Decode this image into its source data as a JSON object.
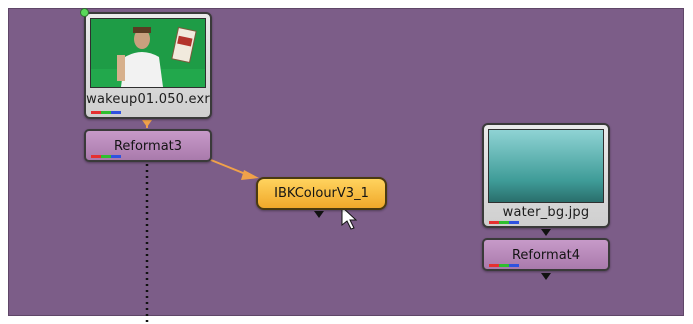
{
  "graph": {
    "background": "#7c5d88",
    "nodes": {
      "read_wakeup": {
        "label": "wakeup01.050.exr",
        "channel_colors": [
          "#e53030",
          "#2fbf2f",
          "#2f52e0"
        ]
      },
      "reformat3": {
        "label": "Reformat3",
        "channel_colors": [
          "#e53030",
          "#2fbf2f",
          "#2f52e0"
        ]
      },
      "ibk_colour": {
        "label": "IBKColourV3_1"
      },
      "read_water": {
        "label": "water_bg.jpg",
        "channel_colors": [
          "#e53030",
          "#2fbf2f",
          "#2f52e0"
        ]
      },
      "reformat4": {
        "label": "Reformat4",
        "channel_colors": [
          "#e53030",
          "#2fbf2f",
          "#2f52e0"
        ]
      }
    },
    "colors": {
      "connection": "#f0a14a",
      "keyer": "#ffc848",
      "reformat": "#b98bbd"
    },
    "icons": [
      "mouse-cursor-icon",
      "output-arrow-icon",
      "viewer-dot-icon"
    ]
  }
}
